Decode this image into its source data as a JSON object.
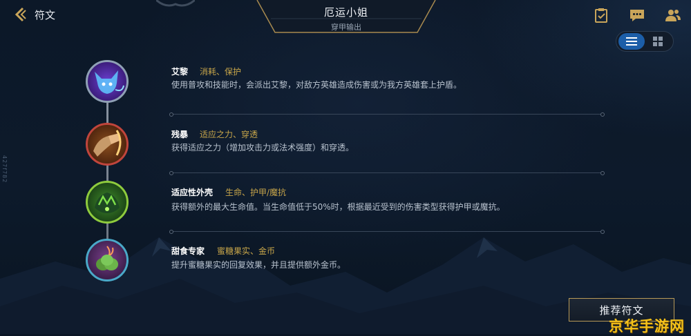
{
  "header": {
    "back_label": "符文",
    "title": "厄运小姐",
    "subtitle": "穿甲输出"
  },
  "top_icons": [
    "clipboard-check-icon",
    "chat-icon",
    "friends-icon"
  ],
  "view_toggle": {
    "selected": "list",
    "options": [
      "list-view",
      "grid-view"
    ]
  },
  "side_code": "427f782",
  "runes": [
    {
      "name": "艾黎",
      "tags": "消耗、保护",
      "desc": "使用普攻和技能时，会派出艾黎，对敌方英雄造成伤害或为我方英雄套上护盾。",
      "icon": "aery-spirit-icon",
      "ring_color": "#8fa0b5"
    },
    {
      "name": "残暴",
      "tags": "适应之力、穿透",
      "desc": "获得适应之力（增加攻击力或法术强度）和穿透。",
      "icon": "brutal-fist-icon",
      "ring_color": "#c0453c"
    },
    {
      "name": "适应性外壳",
      "tags": "生命、护甲/魔抗",
      "desc": "获得额外的最大生命值。当生命值低于50%时，根据最近受到的伤害类型获得护甲或魔抗。",
      "icon": "adaptive-shell-icon",
      "ring_color": "#8ecb3d"
    },
    {
      "name": "甜食专家",
      "tags": "蜜糖果实、金币",
      "desc": "提升蜜糖果实的回复效果，并且提供额外金币。",
      "icon": "honey-fruit-icon",
      "ring_color": "#4aa8c8"
    }
  ],
  "recommend_button": "推荐符文",
  "watermark": "京华手游网",
  "colors": {
    "accent_blue": "#1c5ea8",
    "tag_gold": "#c8a64a",
    "button_border": "#b89a58",
    "watermark": "#f4c21b"
  }
}
